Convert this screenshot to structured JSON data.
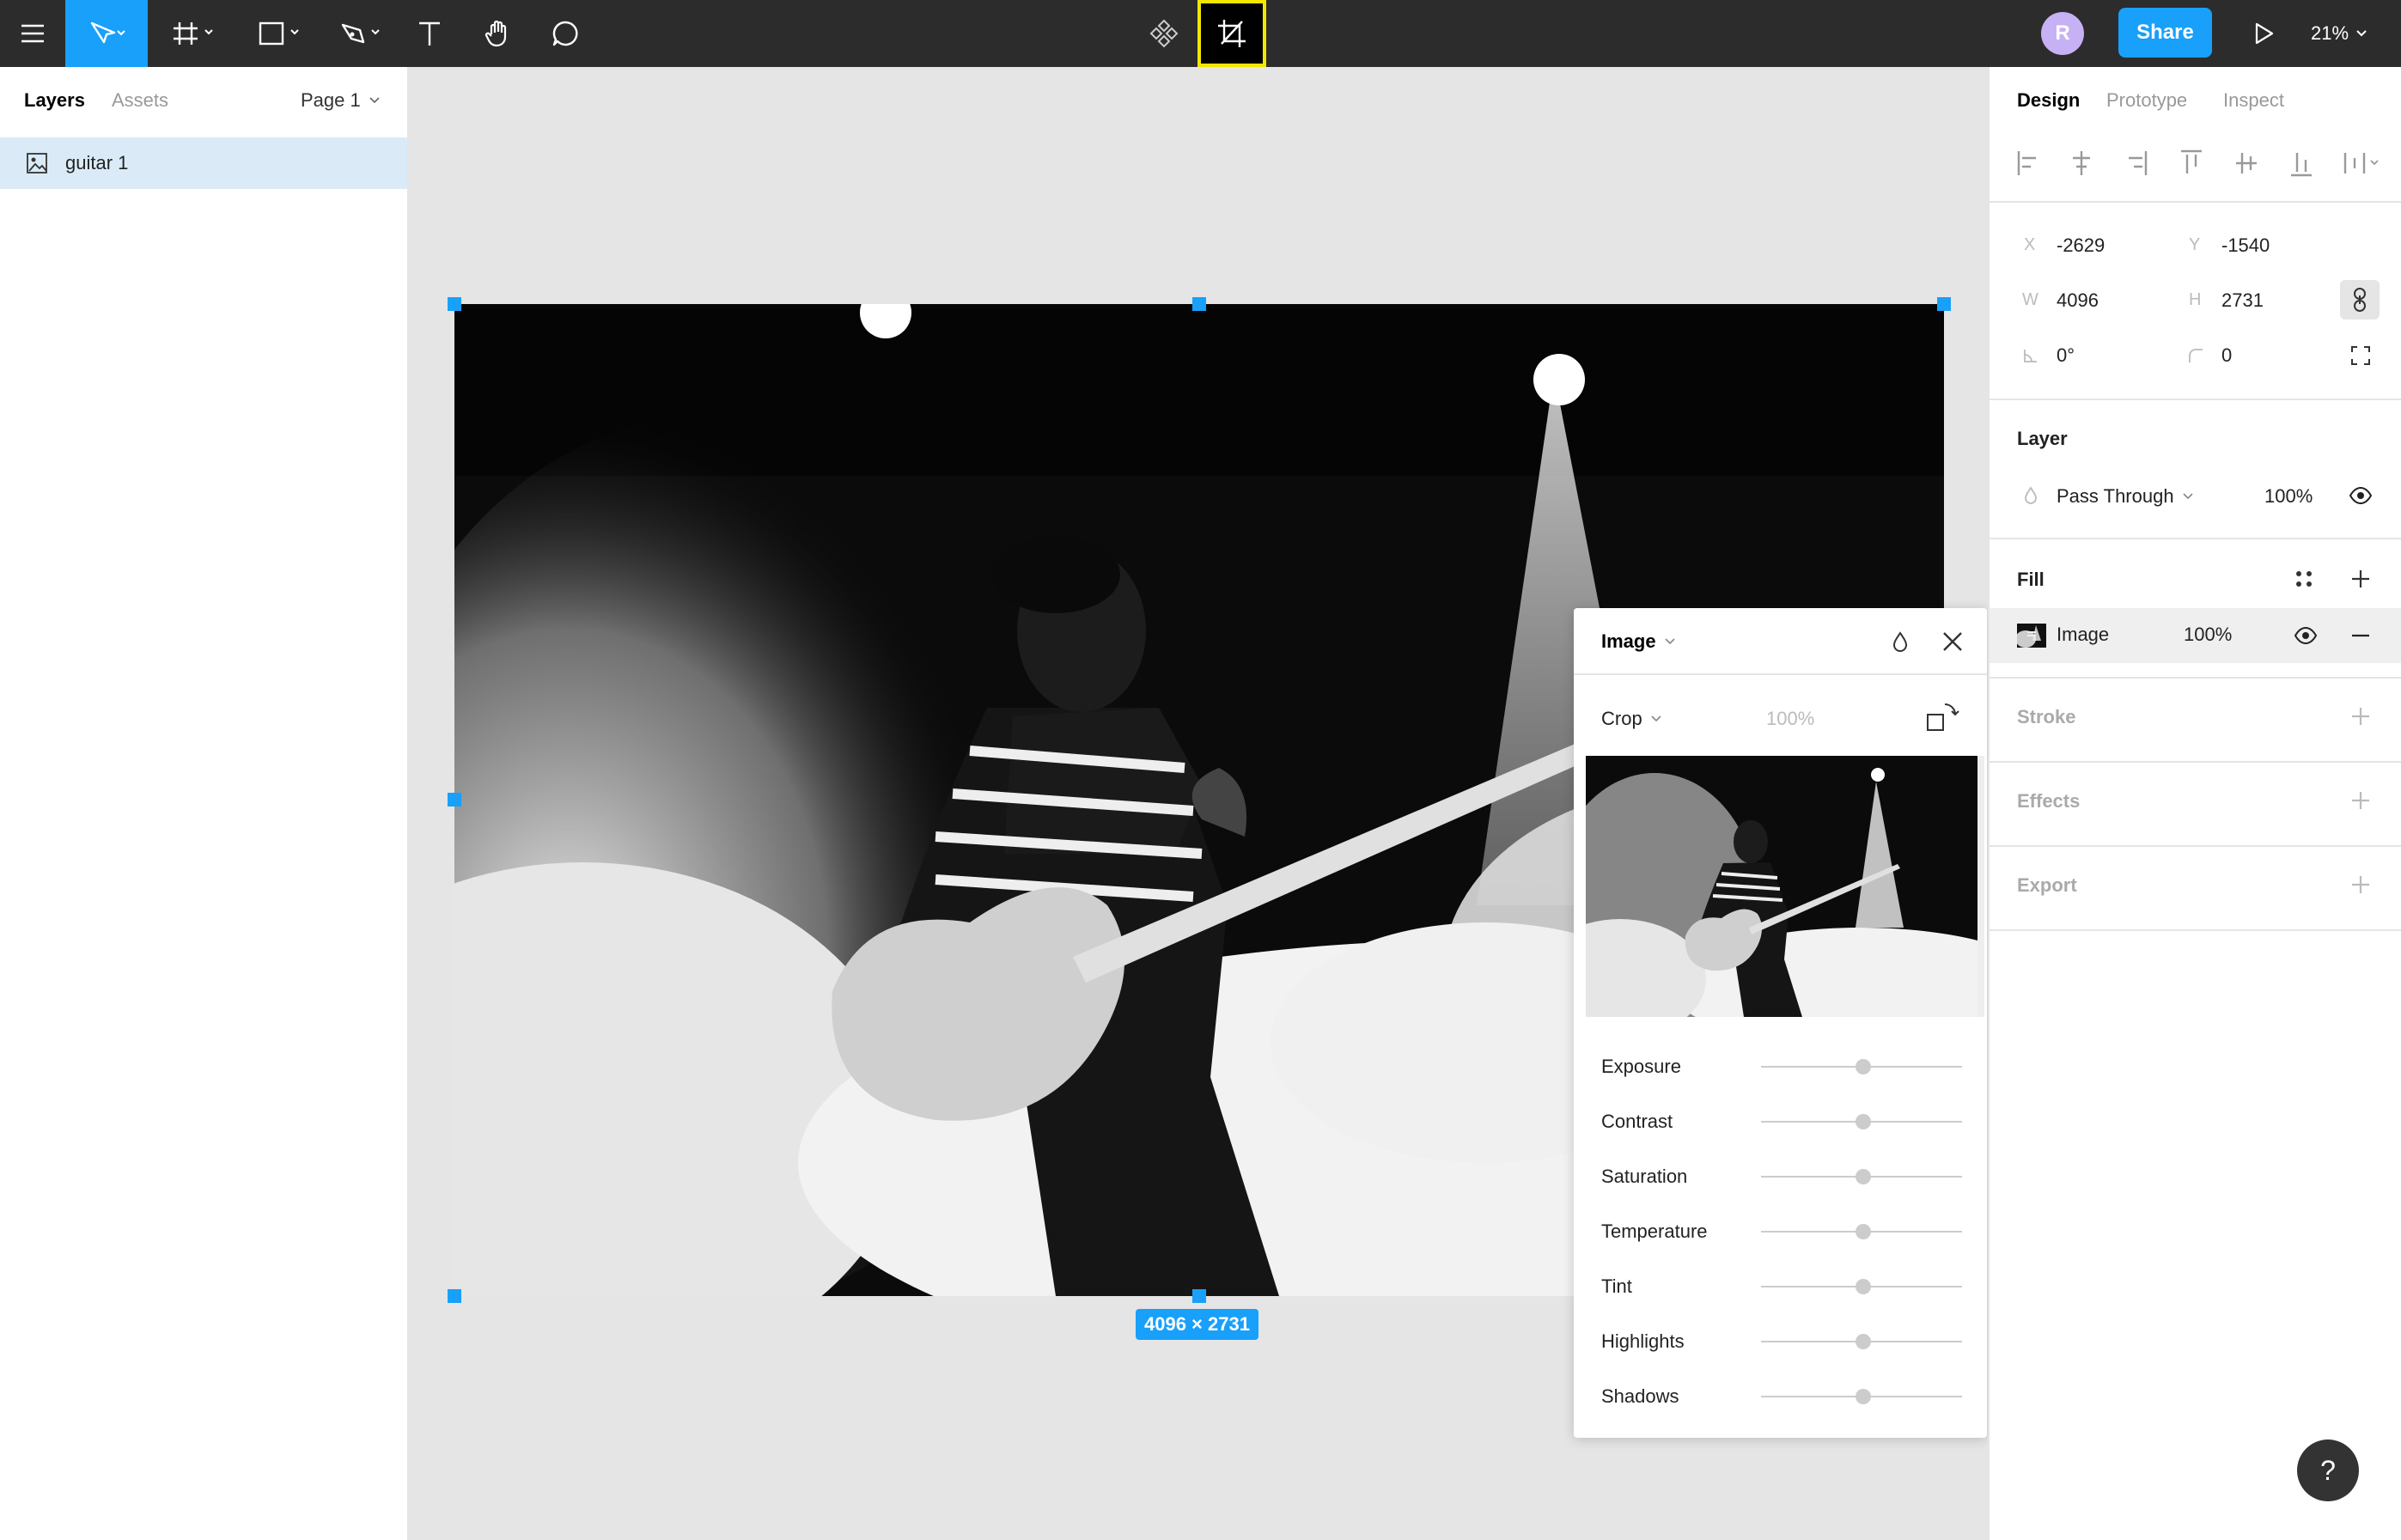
{
  "toolbar": {
    "share_label": "Share",
    "zoom": "21%",
    "avatar_initial": "R",
    "accent": "#18a0fb",
    "crop_highlight": "#f3e600"
  },
  "left_panel": {
    "tab_layers": "Layers",
    "tab_assets": "Assets",
    "page_selector": "Page 1",
    "layers": [
      {
        "name": "guitar 1",
        "icon": "image-icon",
        "selected": true
      }
    ]
  },
  "canvas": {
    "dimensions_label": "4096 × 2731"
  },
  "image_popup": {
    "title": "Image",
    "mode": "Crop",
    "opacity": "100%",
    "adjustments": [
      {
        "label": "Exposure",
        "value": 0
      },
      {
        "label": "Contrast",
        "value": 0
      },
      {
        "label": "Saturation",
        "value": 0
      },
      {
        "label": "Temperature",
        "value": 0
      },
      {
        "label": "Tint",
        "value": 0
      },
      {
        "label": "Highlights",
        "value": 0
      },
      {
        "label": "Shadows",
        "value": 0
      }
    ]
  },
  "right_panel": {
    "tab_design": "Design",
    "tab_prototype": "Prototype",
    "tab_inspect": "Inspect",
    "x_label": "X",
    "x_value": "-2629",
    "y_label": "Y",
    "y_value": "-1540",
    "w_label": "W",
    "w_value": "4096",
    "h_label": "H",
    "h_value": "2731",
    "rotation": "0°",
    "radius": "0",
    "layer_title": "Layer",
    "blend_mode": "Pass Through",
    "layer_opacity": "100%",
    "fill_title": "Fill",
    "fill_type": "Image",
    "fill_opacity": "100%",
    "stroke_title": "Stroke",
    "effects_title": "Effects",
    "export_title": "Export"
  },
  "help_label": "?"
}
